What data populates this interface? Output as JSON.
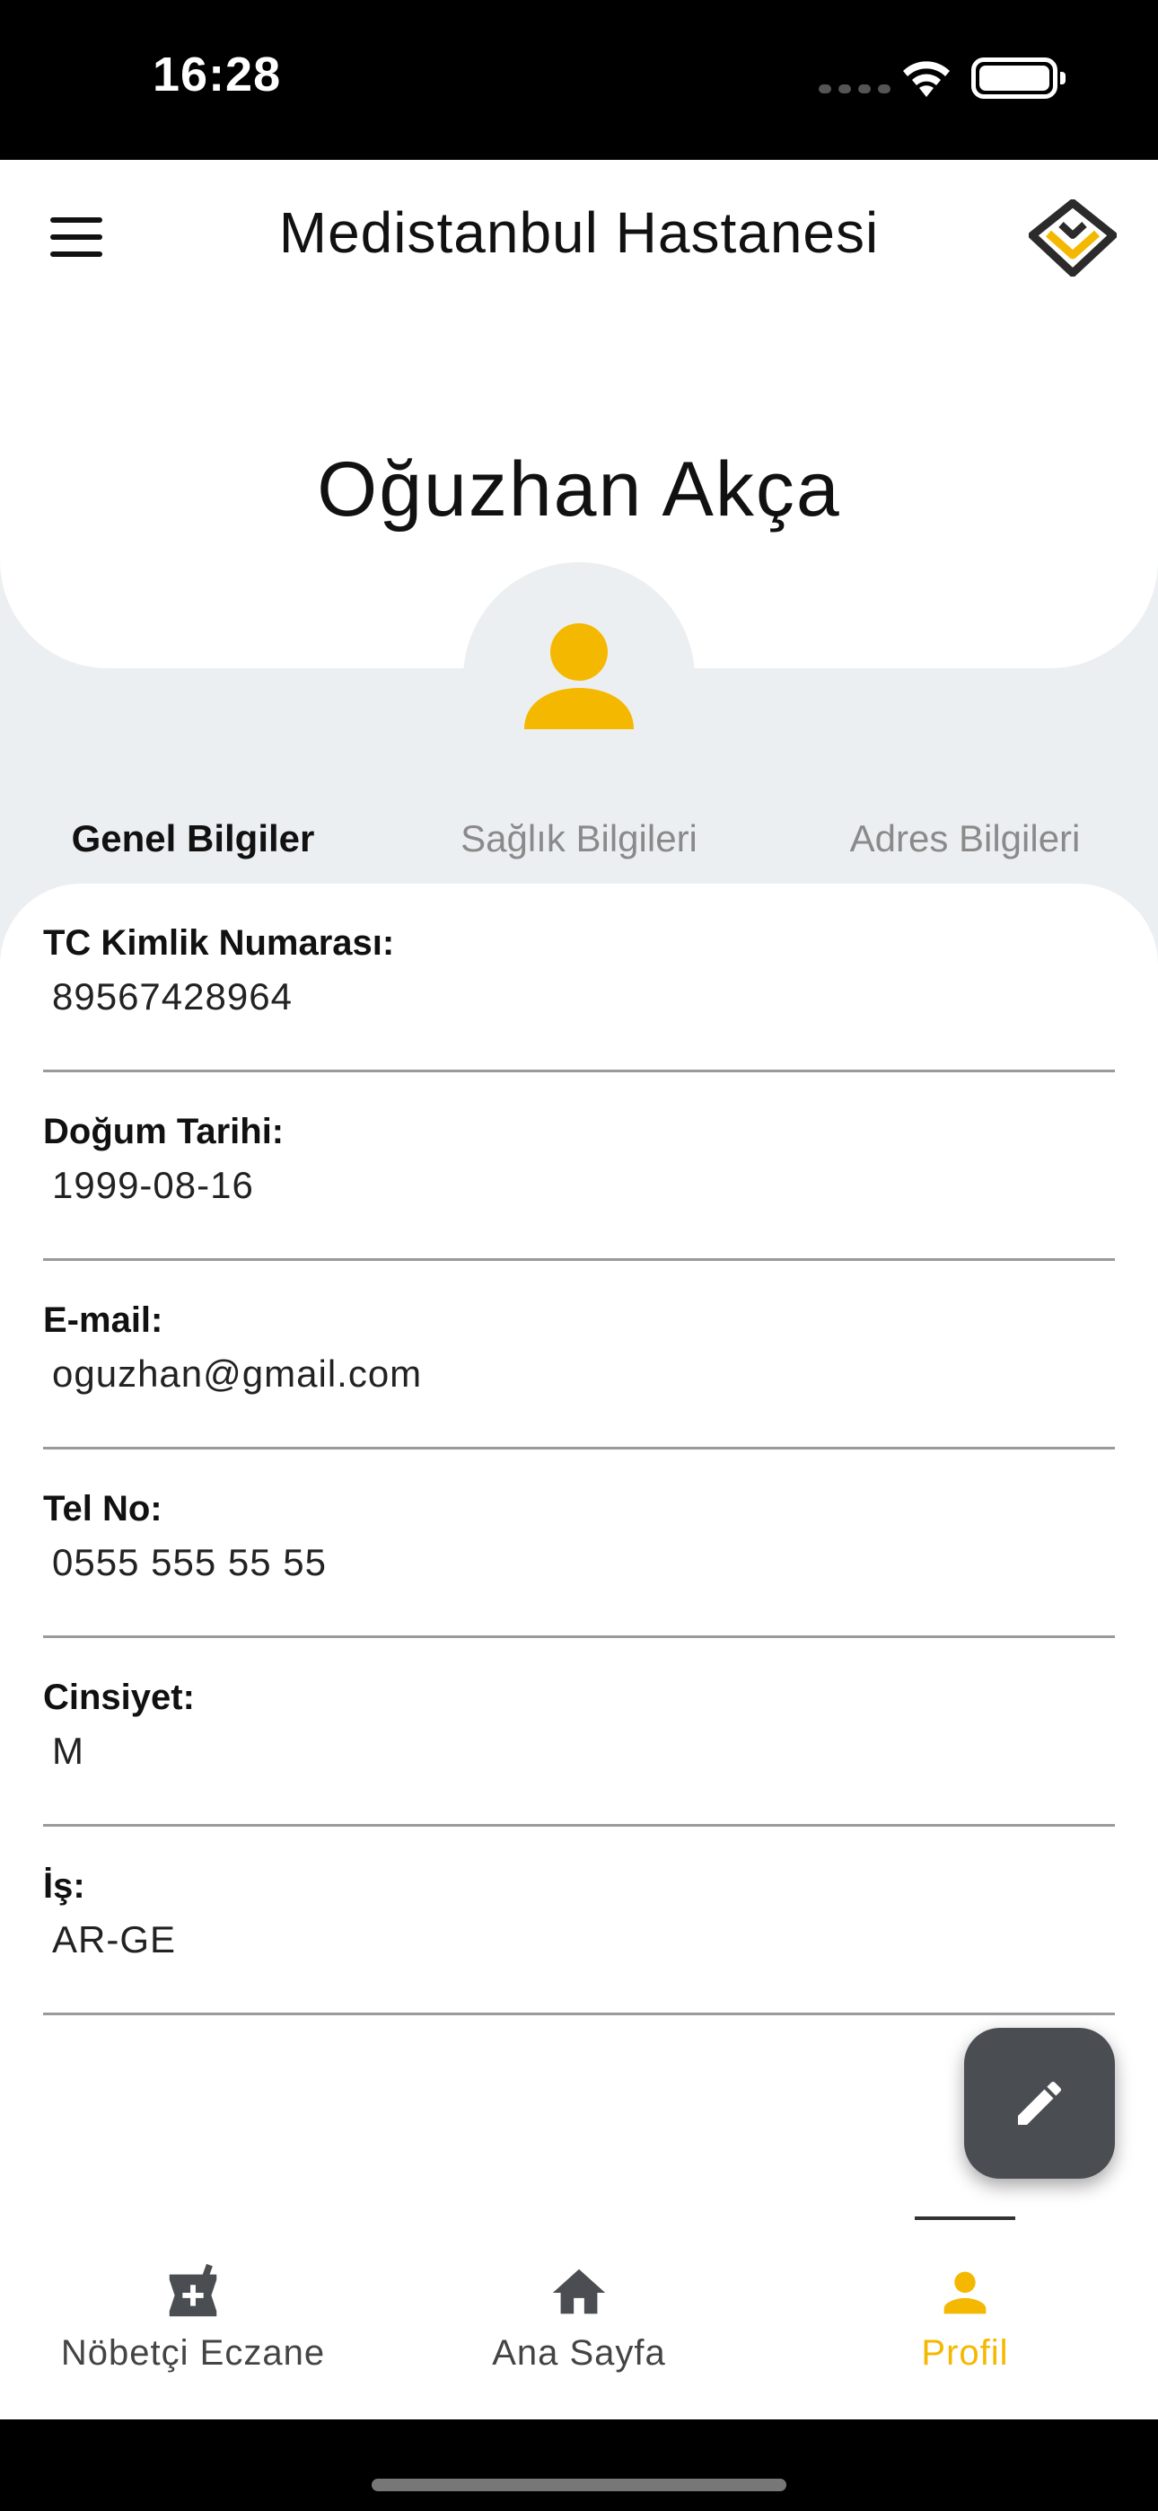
{
  "status_bar": {
    "time": "16:28"
  },
  "header": {
    "title": "Medistanbul Hastanesi",
    "user_name": "Oğuzhan  Akça"
  },
  "tabs": [
    {
      "label": "Genel Bilgiler",
      "active": true
    },
    {
      "label": "Sağlık Bilgileri",
      "active": false
    },
    {
      "label": "Adres Bilgileri",
      "active": false
    }
  ],
  "fields": [
    {
      "label": "TC Kimlik Numarası:",
      "value": "89567428964"
    },
    {
      "label": "Doğum Tarihi:",
      "value": "1999-08-16"
    },
    {
      "label": "E-mail:",
      "value": "oguzhan@gmail.com"
    },
    {
      "label": "Tel No:",
      "value": "0555 555 55 55"
    },
    {
      "label": "Cinsiyet:",
      "value": "M"
    },
    {
      "label": "İş:",
      "value": "AR-GE"
    }
  ],
  "bottom_nav": [
    {
      "label": "Nöbetçi Eczane",
      "icon": "pharmacy-icon"
    },
    {
      "label": "Ana Sayfa",
      "icon": "home-icon"
    },
    {
      "label": "Profil",
      "icon": "person-icon",
      "active": true
    }
  ],
  "colors": {
    "accent": "#f5b800",
    "fab": "#4a4d51",
    "background": "#eceff1"
  }
}
